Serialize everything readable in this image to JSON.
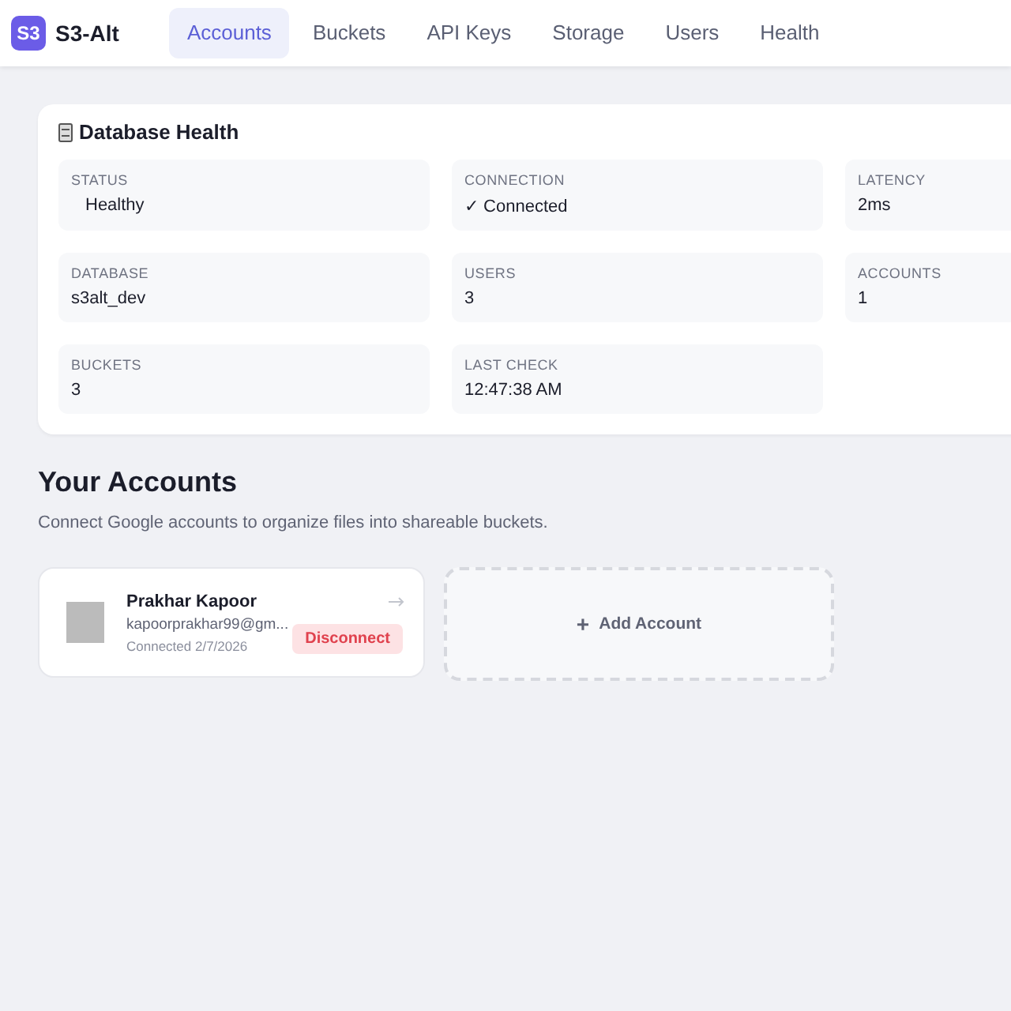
{
  "app": {
    "logo": "S3",
    "name": "S3-Alt"
  },
  "tabs": [
    {
      "label": "Accounts",
      "selected": true
    },
    {
      "label": "Buckets",
      "selected": false
    },
    {
      "label": "API Keys",
      "selected": false
    },
    {
      "label": "Storage",
      "selected": false
    },
    {
      "label": "Users",
      "selected": false
    },
    {
      "label": "Health",
      "selected": false
    }
  ],
  "health": {
    "title": "Database Health",
    "stats": [
      {
        "label": "STATUS",
        "value": "Healthy"
      },
      {
        "label": "CONNECTION",
        "value": "✓ Connected"
      },
      {
        "label": "LATENCY",
        "value": "2ms"
      },
      {
        "label": "DATABASE",
        "value": "s3alt_dev"
      },
      {
        "label": "USERS",
        "value": "3"
      },
      {
        "label": "ACCOUNTS",
        "value": "1"
      },
      {
        "label": "BUCKETS",
        "value": "3"
      },
      {
        "label": "LAST CHECK",
        "value": "12:47:38 AM"
      }
    ]
  },
  "accounts": {
    "title": "Your Accounts",
    "subtitle": "Connect Google accounts to organize files into shareable buckets.",
    "items": [
      {
        "name": "Prakhar Kapoor",
        "email": "kapoorprakhar99@gm...",
        "connected": "Connected 2/7/2026",
        "action": "Disconnect"
      }
    ],
    "add": {
      "icon": "+",
      "label": "Add Account"
    }
  }
}
